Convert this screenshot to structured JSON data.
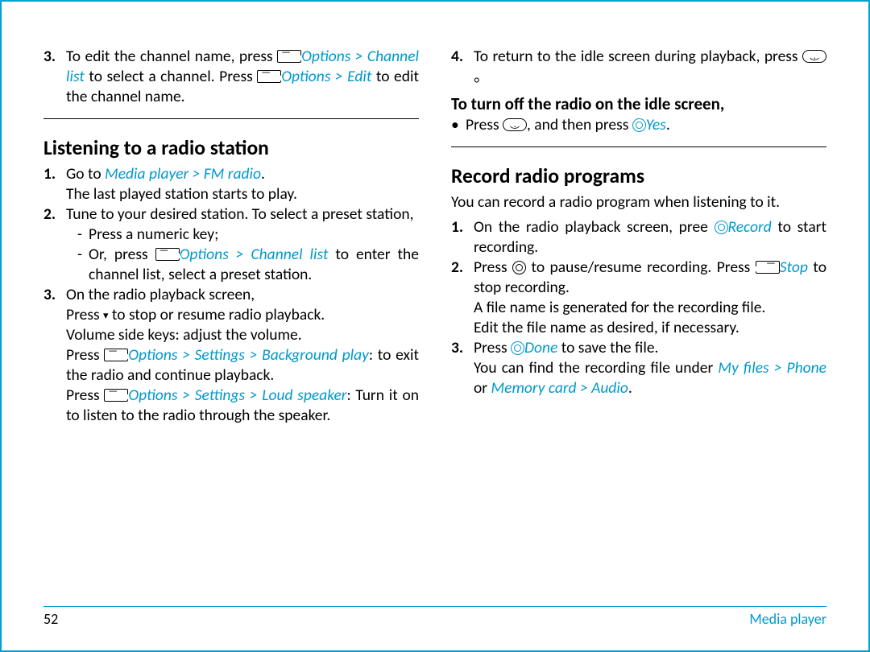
{
  "col1": {
    "item3_pre": "To edit the channel name, press ",
    "item3_opt": "Options > Channel list",
    "item3_mid": " to select a channel. Press ",
    "item3_opt2": "Options > Edit",
    "item3_end": " to edit the channel name.",
    "h_listening": "Listening to a radio station",
    "l1_pre": "Go to ",
    "l1_path": "Media player > FM radio",
    "l1_post": ".",
    "l1_line2": "The last played station starts to play.",
    "l2_line1": "Tune to your desired station. To select a preset station,",
    "l2_sub1": "Press a numeric key;",
    "l2_sub2_pre": "Or, press ",
    "l2_sub2_path": "Options > Channel list",
    "l2_sub2_post": " to enter the channel list, select a preset station.",
    "l3_line1": "On the radio playback screen,",
    "l3_line2_pre": "Press ",
    "l3_line2_post": " to stop or resume radio playback.",
    "l3_line3": "Volume side keys: adjust the volume.",
    "l3_line4_pre": "Press ",
    "l3_line4_path": "Options > Settings > Background play",
    "l3_line4_post": ": to exit the radio and continue playback.",
    "l3_line5_pre": "Press ",
    "l3_line5_path": "Options > Settings > Loud speaker",
    "l3_line5_post": ": Turn it on to listen to the radio through the speaker."
  },
  "col2": {
    "item4_pre": "To return to the idle screen during playback, press ",
    "item4_end": "。",
    "h_turnoff": "To turn off the radio on the idle screen,",
    "turnoff_pre": "Press ",
    "turnoff_mid": ", and then press ",
    "turnoff_yes": "Yes",
    "turnoff_end": ".",
    "h_record": "Record radio programs",
    "rec_intro": "You can record a radio program when listening to it.",
    "r1_pre": "On the radio playback screen, pree ",
    "r1_rec": "Record",
    "r1_post": " to start recording.",
    "r2_pre": "Press ",
    "r2_mid": " to pause/resume recording. Press ",
    "r2_stop": "Stop",
    "r2_post": " to stop recording.",
    "r2_line2": "A file name is generated for the recording file.",
    "r2_line3": "Edit the file name as desired, if necessary.",
    "r3_pre": "Press ",
    "r3_done": "Done",
    "r3_post": " to save the file.",
    "r3_line2_pre": "You can find the recording file under ",
    "r3_line2_path1": "My files > Phone",
    "r3_line2_or": " or ",
    "r3_line2_path2": "Memory card > Audio",
    "r3_line2_end": "."
  },
  "footer": {
    "page": "52",
    "section": "Media player"
  }
}
